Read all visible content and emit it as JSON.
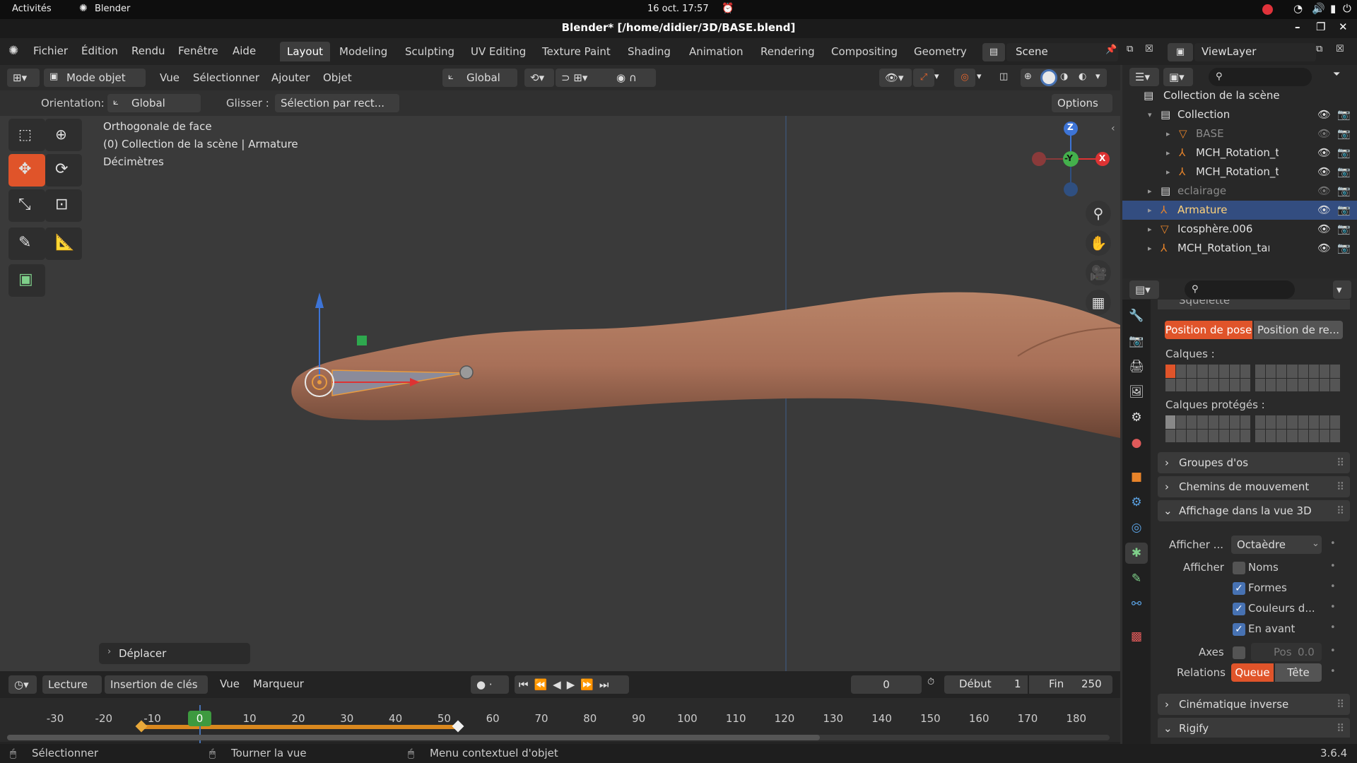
{
  "gnome": {
    "activities": "Activités",
    "app": "Blender",
    "clock": "16 oct.  17:57"
  },
  "window_title": "Blender* [/home/didier/3D/BASE.blend]",
  "menus": [
    "Fichier",
    "Édition",
    "Rendu",
    "Fenêtre",
    "Aide"
  ],
  "workspaces": [
    "Layout",
    "Modeling",
    "Sculpting",
    "UV Editing",
    "Texture Paint",
    "Shading",
    "Animation",
    "Rendering",
    "Compositing",
    "Geometry N"
  ],
  "scene": "Scene",
  "view_layer": "ViewLayer",
  "header": {
    "mode": "Mode objet",
    "menus": [
      "Vue",
      "Sélectionner",
      "Ajouter",
      "Objet"
    ],
    "transform_orientation": "Global"
  },
  "header2": {
    "orientation_label": "Orientation:",
    "orientation_value": "Global",
    "drag_label": "Glisser :",
    "drag_value": "Sélection par rect...",
    "options": "Options"
  },
  "viewport": {
    "line1": "Orthogonale de face",
    "line2": "(0) Collection de la scène | Armature",
    "line3": "Décimètres",
    "operator_panel": "Déplacer",
    "gizmo": {
      "z": "Z",
      "y": "-Y",
      "x": "X"
    }
  },
  "outliner": {
    "root": "Collection de la scène",
    "items": [
      {
        "name": "Collection",
        "depth": 1,
        "icon": "collection-icon"
      },
      {
        "name": "BASE",
        "depth": 2,
        "icon": "mesh-icon",
        "dim": true
      },
      {
        "name": "MCH_Rotation_ta",
        "depth": 2,
        "icon": "armature-icon"
      },
      {
        "name": "MCH_Rotation_ta",
        "depth": 2,
        "icon": "armature-icon"
      },
      {
        "name": "eclairage",
        "depth": 1,
        "icon": "collection-icon",
        "dim": true
      },
      {
        "name": "Armature",
        "depth": 1,
        "icon": "armature-icon",
        "selected": true
      },
      {
        "name": "Icosphère.006",
        "depth": 1,
        "icon": "mesh-icon"
      },
      {
        "name": "MCH_Rotation_target",
        "depth": 1,
        "icon": "armature-icon"
      }
    ]
  },
  "props": {
    "partial_top": "Squelette",
    "pose_btn": "Position de pose",
    "rest_btn": "Position de re...",
    "layers": "Calques :",
    "protected_layers": "Calques protégés :",
    "panels": {
      "bone_groups": "Groupes d'os",
      "motion_paths": "Chemins de mouvement",
      "viewport_display": "Affichage dans la vue 3D",
      "ik": "Cinématique inverse",
      "rigify": "Rigify"
    },
    "display_as_label": "Afficher ...",
    "display_as_value": "Octaèdre",
    "show_label": "Afficher",
    "names": "Noms",
    "shapes": "Formes",
    "group_colors": "Couleurs d...",
    "in_front": "En avant",
    "axes_label": "Axes",
    "axes_pos_label": "Pos",
    "axes_pos_value": "0.0",
    "relations_label": "Relations",
    "tail": "Queue",
    "head": "Tête"
  },
  "timeline": {
    "menus": [
      "Lecture",
      "Insertion de clés",
      "Vue",
      "Marqueur"
    ],
    "current_frame": "0",
    "start_label": "Début",
    "start": "1",
    "end_label": "Fin",
    "end": "250",
    "ticks": [
      "-30",
      "-20",
      "-10",
      "0",
      "10",
      "20",
      "30",
      "40",
      "50",
      "60",
      "70",
      "80",
      "90",
      "100",
      "110",
      "120",
      "130",
      "140",
      "150",
      "160",
      "170",
      "180"
    ]
  },
  "status": {
    "select": "Sélectionner",
    "rotate": "Tourner la vue",
    "context": "Menu contextuel d'objet",
    "version": "3.6.4"
  }
}
